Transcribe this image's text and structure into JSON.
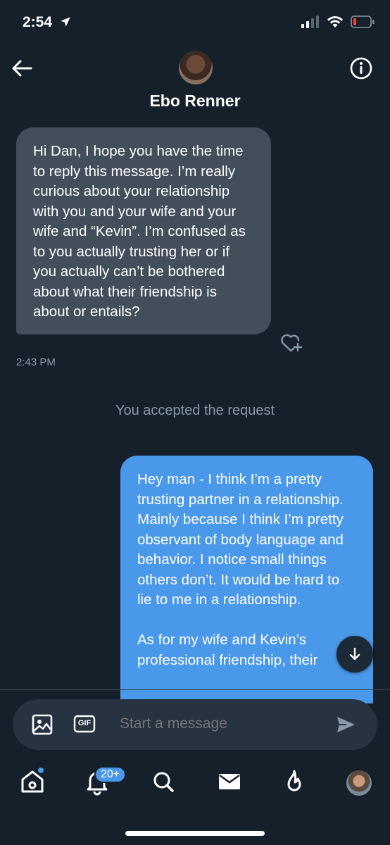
{
  "status_bar": {
    "time": "2:54"
  },
  "header": {
    "contact_name": "Ebo Renner"
  },
  "messages": {
    "incoming_text": "Hi Dan, I hope you have the time to reply this message. I’m really curious about your relationship with you and your wife and your wife and “Kevin”. I’m confused as to you actually trusting her or if you actually can’t be bothered about what their friendship is about or entails?",
    "incoming_time": "2:43 PM",
    "system_notice": "You accepted the request",
    "outgoing_text": "Hey man - I think I’m a pretty trusting partner in a relationship. Mainly because I think I’m pretty observant of body language and behavior. I notice small things others don’t. It would be hard to lie to me in a relationship.\n\nAs for my wife and Kevin’s professional friendship, their"
  },
  "composer": {
    "placeholder": "Start a message",
    "gif_label": "GIF"
  },
  "tab_bar": {
    "notifications_badge": "20+"
  },
  "colors": {
    "background": "#15202b",
    "accent": "#4a98e9",
    "incoming_bubble": "#434e5b",
    "muted_text": "#8899a6"
  }
}
